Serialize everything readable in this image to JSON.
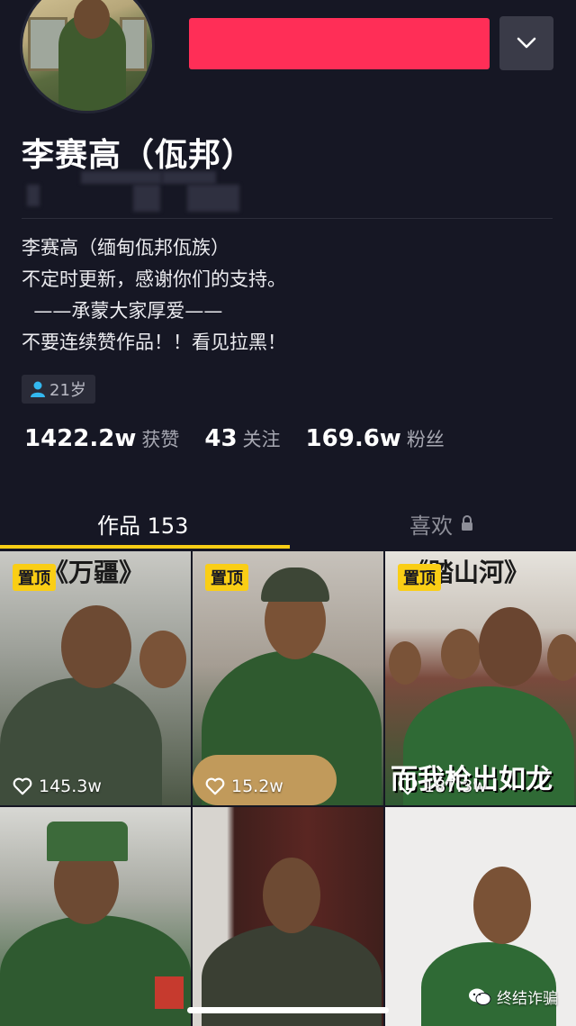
{
  "profile": {
    "name": "李赛高（佤邦）",
    "bio_lines": [
      "李赛高（缅甸佤邦佤族）",
      "不定时更新，感谢你们的支持。",
      "  ——承蒙大家厚爱——",
      "不要连续赞作品！！看见拉黑！"
    ],
    "age": "21岁"
  },
  "stats": {
    "likes_value": "1422.2w",
    "likes_label": "获赞",
    "following_value": "43",
    "following_label": "关注",
    "followers_value": "169.6w",
    "followers_label": "粉丝"
  },
  "tabs": {
    "works": "作品 153",
    "likes": "喜欢"
  },
  "videos": [
    {
      "pinned": "置顶",
      "title": "《万疆》",
      "likes": "145.3w"
    },
    {
      "pinned": "置顶",
      "title": "",
      "likes": "15.2w"
    },
    {
      "pinned": "置顶",
      "title": "《踏山河》",
      "subtitle": "而我枪出如龙",
      "likes": "187.3w"
    },
    {
      "pinned": "",
      "title": "",
      "likes": ""
    },
    {
      "pinned": "",
      "title": "",
      "likes": ""
    },
    {
      "pinned": "",
      "title": "",
      "likes": ""
    }
  ],
  "watermark": "终结诈骗",
  "colors": {
    "accent": "#face15",
    "redaction": "#ff2e57",
    "background": "#161724"
  }
}
